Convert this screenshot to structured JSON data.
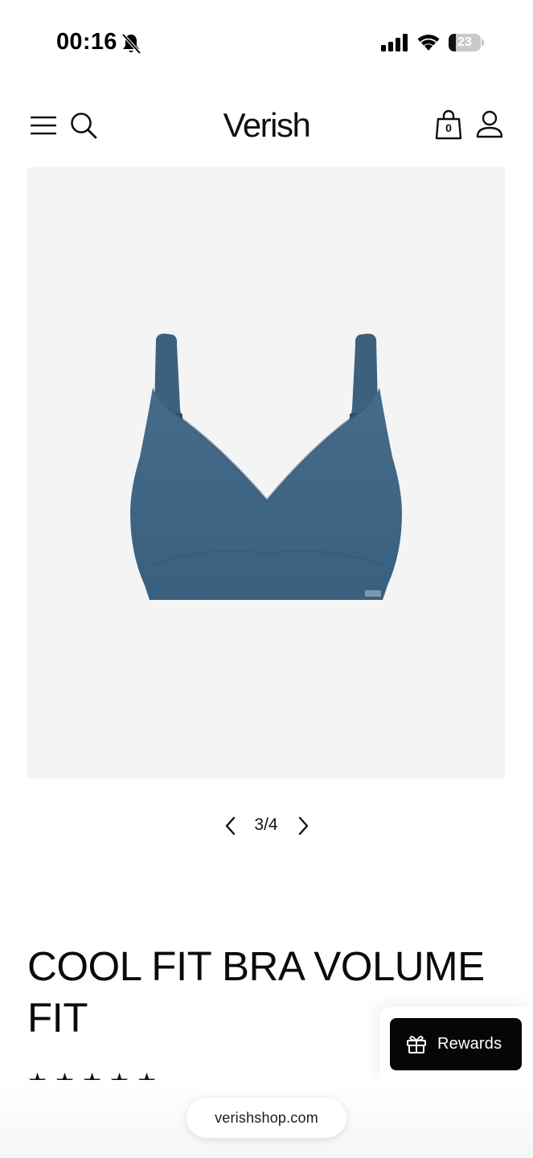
{
  "status_bar": {
    "time": "00:16",
    "battery_level": "23",
    "battery_fraction": 0.23,
    "icons": [
      "bell-slash-icon",
      "signal-icon",
      "wifi-icon",
      "battery-icon"
    ]
  },
  "header": {
    "brand": "Verish",
    "cart_count": "0",
    "icons": [
      "menu-icon",
      "search-icon",
      "shopping-bag-icon",
      "account-icon"
    ]
  },
  "gallery": {
    "image_alt": "Blue bra product photo",
    "pager": "3/4",
    "product_color": "#3f6583",
    "background": "#f4f4f4"
  },
  "product": {
    "title": "COOL FIT BRA VOLUME FIT",
    "rating_stars": 5
  },
  "rewards": {
    "label": "Rewards",
    "icon": "gift-icon"
  },
  "browser": {
    "url": "verishshop.com"
  }
}
